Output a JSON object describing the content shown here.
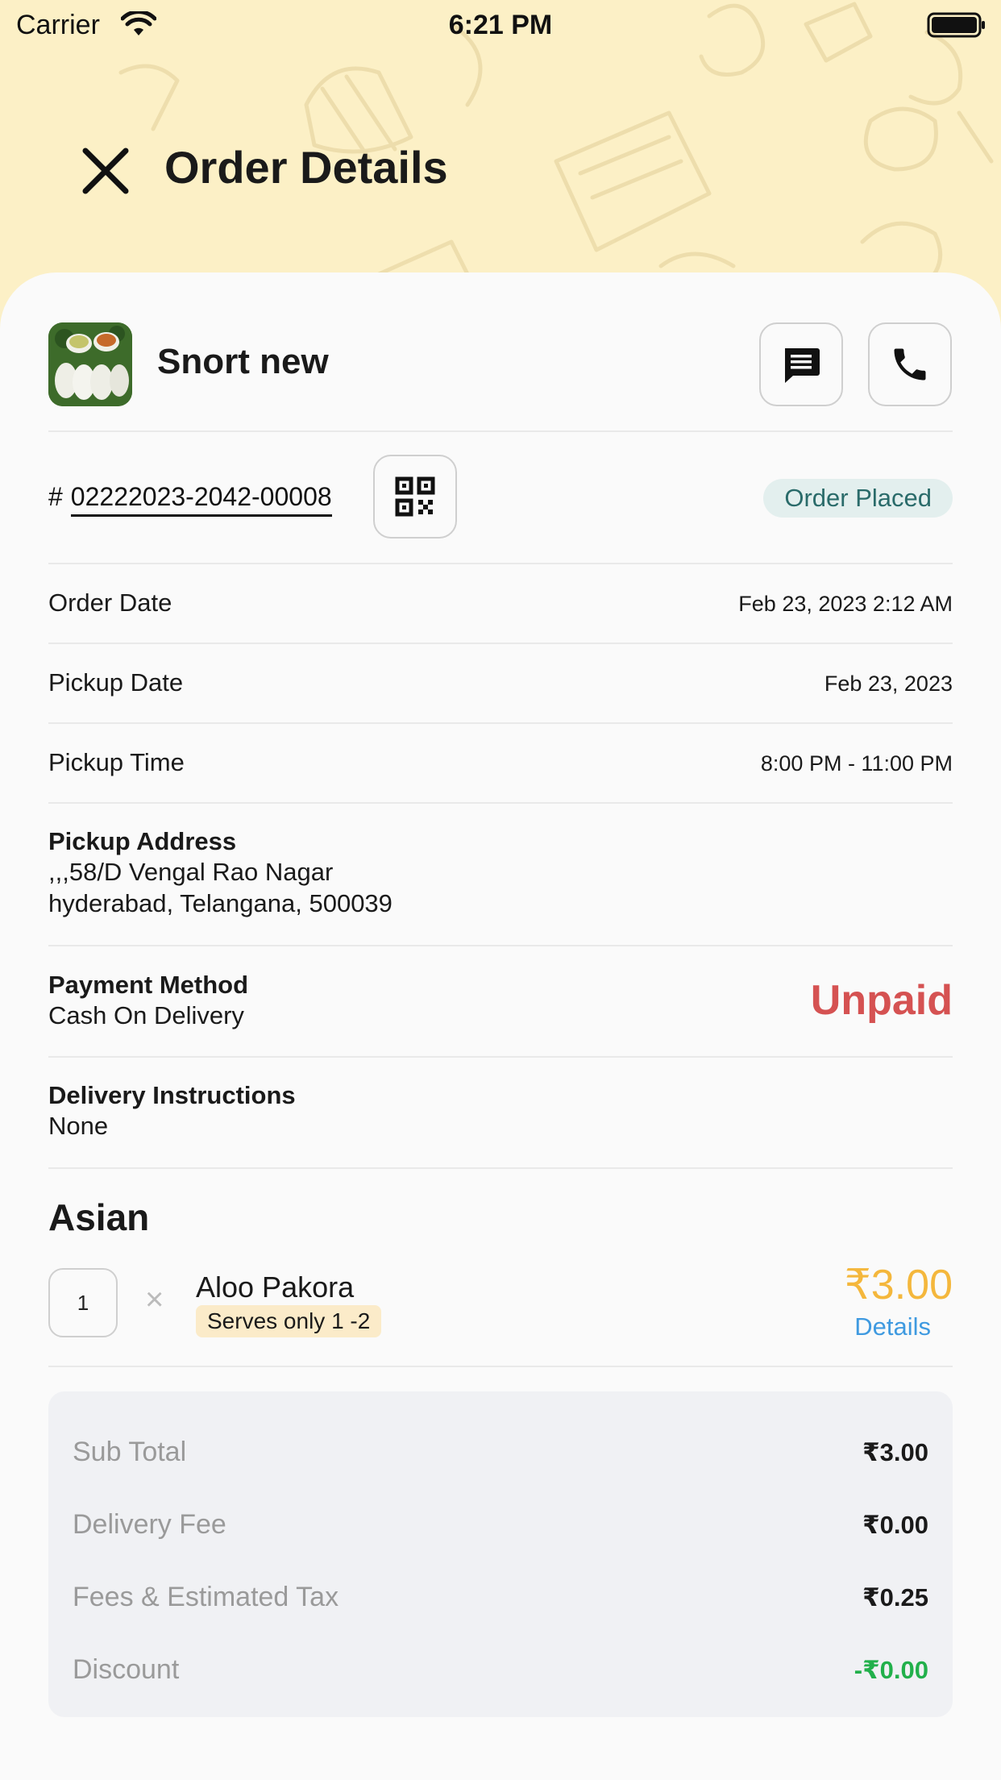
{
  "status_bar": {
    "carrier": "Carrier",
    "time": "6:21 PM"
  },
  "header": {
    "title": "Order Details"
  },
  "store": {
    "name": "Snort new"
  },
  "order": {
    "hash": "#",
    "number": "02222023-2042-00008",
    "status": "Order Placed"
  },
  "details": [
    {
      "label": "Order Date",
      "value": "Feb 23, 2023 2:12 AM"
    },
    {
      "label": "Pickup Date",
      "value": "Feb 23, 2023"
    },
    {
      "label": "Pickup Time",
      "value": "8:00 PM - 11:00 PM"
    }
  ],
  "pickup_address": {
    "title": "Pickup Address",
    "line1": ",,,58/D Vengal Rao Nagar",
    "line2": "hyderabad, Telangana, 500039"
  },
  "payment": {
    "title": "Payment Method",
    "method": "Cash On Delivery",
    "status": "Unpaid"
  },
  "delivery_instructions": {
    "title": "Delivery Instructions",
    "text": "None"
  },
  "category": {
    "name": "Asian"
  },
  "item": {
    "quantity": "1",
    "times": "×",
    "name": "Aloo Pakora",
    "serves": "Serves only 1 -2",
    "price": "₹3.00",
    "details_label": "Details"
  },
  "summary": {
    "subtotal_label": "Sub Total",
    "subtotal_value": "₹3.00",
    "delivery_label": "Delivery Fee",
    "delivery_value": "₹0.00",
    "tax_label": "Fees & Estimated Tax",
    "tax_value": "₹0.25",
    "discount_label": "Discount",
    "discount_value": "-₹0.00"
  },
  "colors": {
    "header_bg": "#fcf0c6",
    "unpaid": "#d55252",
    "price": "#f4b73c",
    "link": "#3f9ae0",
    "discount": "#22b04b",
    "status_pill_bg": "#e3efee",
    "status_pill_text": "#2a6b6a"
  }
}
